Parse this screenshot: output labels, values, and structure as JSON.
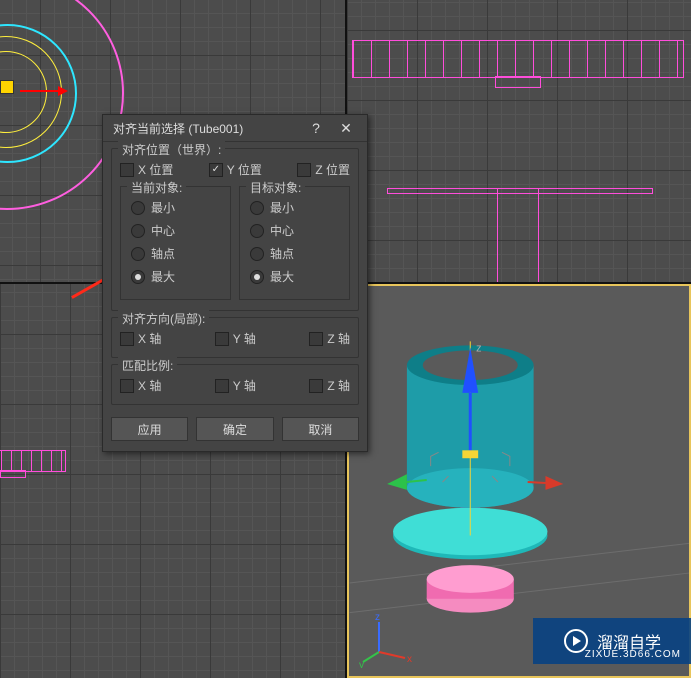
{
  "dialog": {
    "title": "对齐当前选择 (Tube001)",
    "help_icon": "?",
    "close_icon": "✕",
    "align_position": {
      "label": "对齐位置（世界）:",
      "x": "X 位置",
      "y": "Y 位置",
      "z": "Z 位置",
      "x_checked": false,
      "y_checked": true,
      "z_checked": false,
      "current": {
        "label": "当前对象:",
        "min": "最小",
        "center": "中心",
        "pivot": "轴点",
        "max": "最大",
        "selected": "max"
      },
      "target": {
        "label": "目标对象:",
        "min": "最小",
        "center": "中心",
        "pivot": "轴点",
        "max": "最大",
        "selected": "max"
      }
    },
    "align_orientation": {
      "label": "对齐方向(局部):",
      "x": "X 轴",
      "y": "Y 轴",
      "z": "Z 轴"
    },
    "match_scale": {
      "label": "匹配比例:",
      "x": "X 轴",
      "y": "Y 轴",
      "z": "Z 轴"
    },
    "buttons": {
      "apply": "应用",
      "ok": "确定",
      "cancel": "取消"
    }
  },
  "viewport": {
    "perspective_bracket": "]",
    "gizmo_z": "z",
    "tripod_x": "x",
    "tripod_y": "y",
    "tripod_z": "z"
  },
  "watermark": {
    "text": "溜溜自学",
    "sub": "ZIXUE.3D66.COM"
  }
}
